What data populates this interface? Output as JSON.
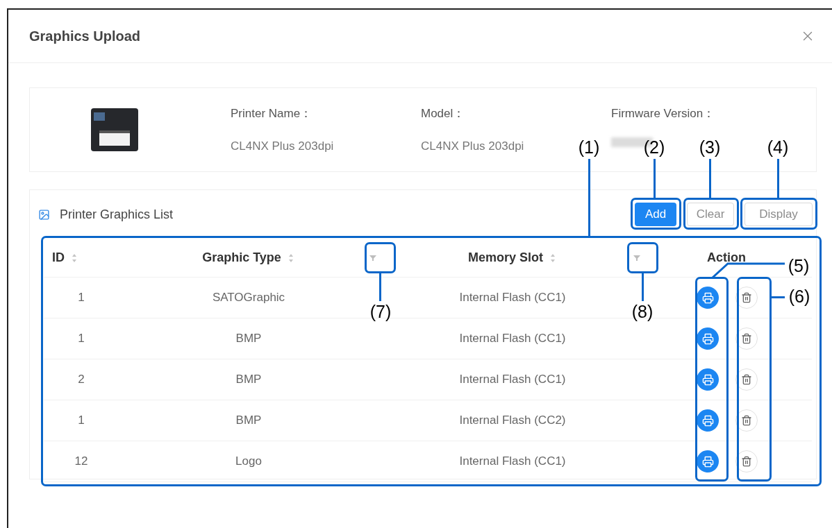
{
  "dialog": {
    "title": "Graphics Upload"
  },
  "printer_info": {
    "fields": [
      {
        "label": "Printer Name：",
        "value": "CL4NX Plus 203dpi"
      },
      {
        "label": "Model：",
        "value": "CL4NX Plus 203dpi"
      },
      {
        "label": "Firmware Version：",
        "value_obscured": true
      }
    ]
  },
  "graphics_list": {
    "title": "Printer Graphics List",
    "buttons": [
      {
        "label": "Add",
        "disabled": false
      },
      {
        "label": "Clear",
        "disabled": true
      },
      {
        "label": "Display",
        "disabled": true
      }
    ],
    "columns": [
      {
        "label": "ID",
        "sortable": true,
        "filterable": false
      },
      {
        "label": "Graphic Type",
        "sortable": true,
        "filterable": true
      },
      {
        "label": "Memory Slot",
        "sortable": true,
        "filterable": true
      },
      {
        "label": "Action",
        "sortable": false,
        "filterable": false
      }
    ],
    "rows": [
      {
        "id": "1",
        "graphic_type": "SATOGraphic",
        "memory_slot": "Internal Flash (CC1)"
      },
      {
        "id": "1",
        "graphic_type": "BMP",
        "memory_slot": "Internal Flash (CC1)"
      },
      {
        "id": "2",
        "graphic_type": "BMP",
        "memory_slot": "Internal Flash (CC1)"
      },
      {
        "id": "1",
        "graphic_type": "BMP",
        "memory_slot": "Internal Flash (CC2)"
      },
      {
        "id": "12",
        "graphic_type": "Logo",
        "memory_slot": "Internal Flash (CC1)"
      }
    ]
  },
  "callouts": [
    {
      "label": "(1)"
    },
    {
      "label": "(2)"
    },
    {
      "label": "(3)"
    },
    {
      "label": "(4)"
    },
    {
      "label": "(5)"
    },
    {
      "label": "(6)"
    },
    {
      "label": "(7)"
    },
    {
      "label": "(8)"
    }
  ]
}
